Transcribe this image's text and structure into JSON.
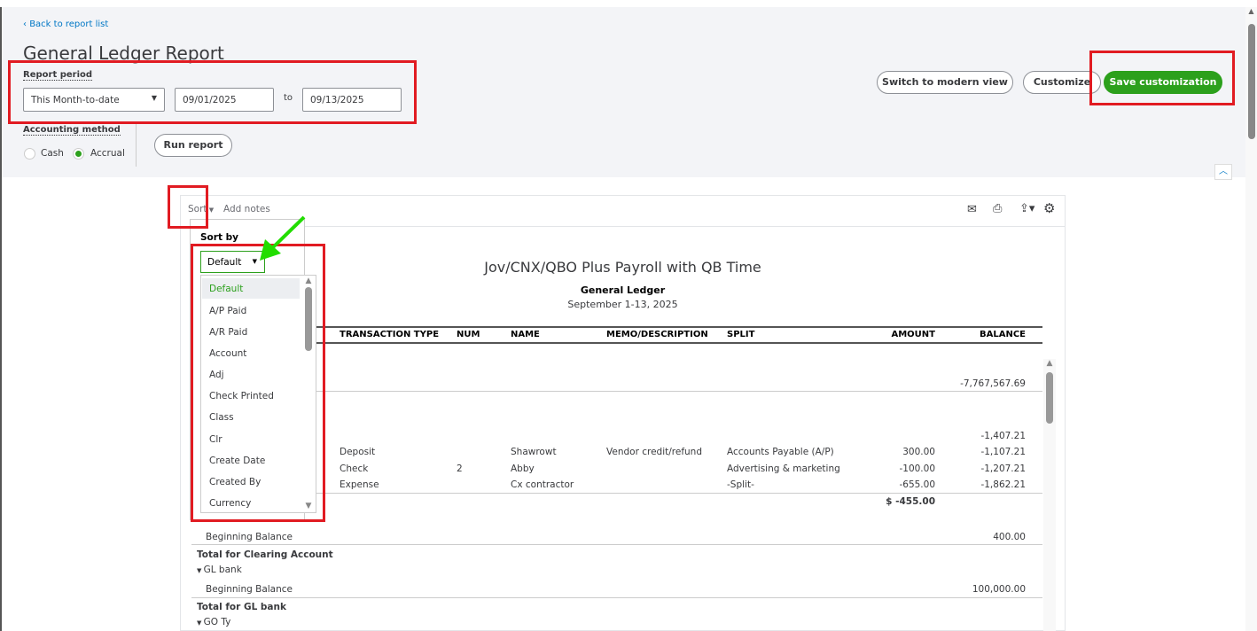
{
  "header": {
    "back_link": "Back to report list",
    "title": "General Ledger Report",
    "report_period_label": "Report period",
    "period_select": "This Month-to-date",
    "start_date": "09/01/2025",
    "to_label": "to",
    "end_date": "09/13/2025",
    "accounting_method_label": "Accounting method",
    "methods": [
      "Cash",
      "Accrual"
    ],
    "selected_method": "Accrual",
    "run_report": "Run report",
    "switch_view": "Switch to modern view",
    "customize": "Customize",
    "save_customization": "Save customization"
  },
  "toolbar": {
    "sort": "Sort",
    "add_notes": "Add notes"
  },
  "sort_popup": {
    "label": "Sort by",
    "selected": "Default",
    "options": [
      "Default",
      "A/P Paid",
      "A/R Paid",
      "Account",
      "Adj",
      "Check Printed",
      "Class",
      "Clr",
      "Create Date",
      "Created By",
      "Currency"
    ]
  },
  "report": {
    "company": "Jov/CNX/QBO Plus Payroll with QB Time",
    "name": "General Ledger",
    "period": "September 1-13, 2025",
    "columns": [
      "TRANSACTION TYPE",
      "NUM",
      "NAME",
      "MEMO/DESCRIPTION",
      "SPLIT",
      "AMOUNT",
      "BALANCE"
    ],
    "balance1": "-7,767,567.69",
    "balance2": "-1,407.21",
    "rows": [
      {
        "type": "Deposit",
        "num": "",
        "name": "Shawrowt",
        "memo": "Vendor credit/refund",
        "split": "Accounts Payable (A/P)",
        "amount": "300.00",
        "balance": "-1,107.21"
      },
      {
        "type": "Check",
        "num": "2",
        "name": "Abby",
        "memo": "",
        "split": "Advertising & marketing",
        "amount": "-100.00",
        "balance": "-1,207.21"
      },
      {
        "type": "Expense",
        "num": "",
        "name": "Cx contractor",
        "memo": "",
        "split": "-Split-",
        "amount": "-655.00",
        "balance": "-1,862.21"
      }
    ],
    "total_amount": "$ -455.00",
    "beginning_balance": "Beginning Balance",
    "bb1": "400.00",
    "total_clearing": "Total for Clearing Account",
    "gl_bank": "GL bank",
    "bb2": "100,000.00",
    "total_gl": "Total for GL bank",
    "go_ty": "GO Ty"
  },
  "colors": {
    "accent": "#2ca01c",
    "annotation_red": "#e11b22",
    "annotation_arrow": "#22dd00",
    "link": "#0077c5"
  }
}
